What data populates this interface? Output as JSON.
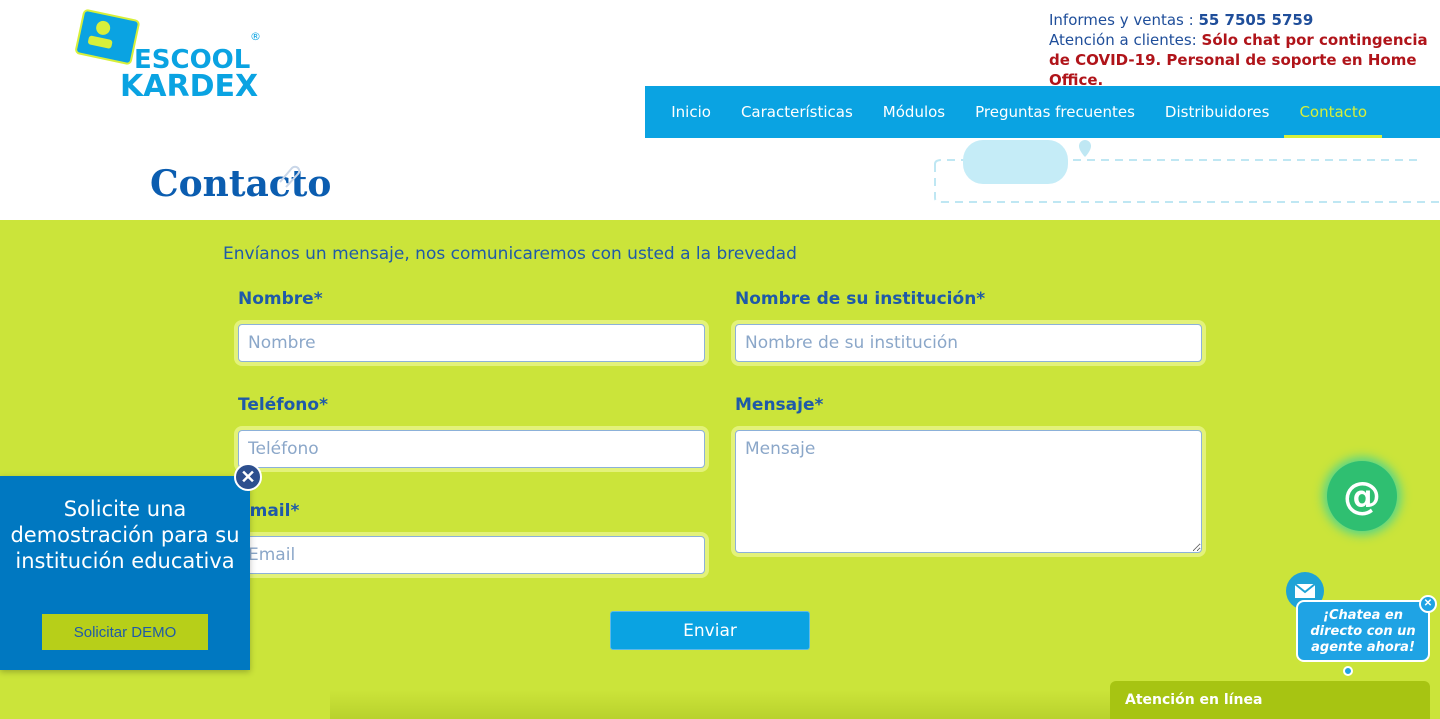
{
  "logo": {
    "line1": "ESCOOL",
    "line2": "KARDEX",
    "registered": "®"
  },
  "contact_info": {
    "sales_label": "Informes  y  ventas : ",
    "sales_phone": "55 7505 5759",
    "support_label": "Atención a clientes: ",
    "support_notice_1": "Sólo chat por contingencia",
    "support_notice_2": "de COVID-19. Personal de soporte en Home Office."
  },
  "nav": {
    "items": [
      {
        "label": "Inicio"
      },
      {
        "label": "Características"
      },
      {
        "label": "Módulos"
      },
      {
        "label": "Preguntas frecuentes"
      },
      {
        "label": "Distribuidores"
      },
      {
        "label": "Contacto"
      }
    ],
    "active": "Contacto"
  },
  "page": {
    "title": "Contacto"
  },
  "form": {
    "intro": "Envíanos un mensaje, nos comunicaremos con usted a la brevedad",
    "name": {
      "label": "Nombre*",
      "placeholder": "Nombre",
      "value": ""
    },
    "institution": {
      "label": "Nombre de su institución*",
      "placeholder": "Nombre de su institución",
      "value": ""
    },
    "phone": {
      "label": "Teléfono*",
      "placeholder": "Teléfono",
      "value": ""
    },
    "message": {
      "label": "Mensaje*",
      "placeholder": "Mensaje",
      "value": ""
    },
    "email": {
      "label": "Email*",
      "placeholder": "Email",
      "value": ""
    },
    "submit_label": "Enviar"
  },
  "demo_popup": {
    "text": "Solicite una demostración para su institución educativa",
    "button_label": "Solicitar DEMO",
    "close_glyph": "✕"
  },
  "chat": {
    "at_symbol": "@",
    "bubble_text": "¡Chatea en directo con un agente ahora!",
    "close_glyph": "✕",
    "bar_label": "Atención en línea"
  },
  "colors": {
    "brand_blue": "#0aa3e2",
    "form_green": "#cbe43a",
    "title_blue": "#0b5db0",
    "label_blue": "#1f5aa8",
    "alert_red": "#b0141a",
    "active_nav": "#d7ef3a",
    "popup_blue": "#0078c1"
  }
}
